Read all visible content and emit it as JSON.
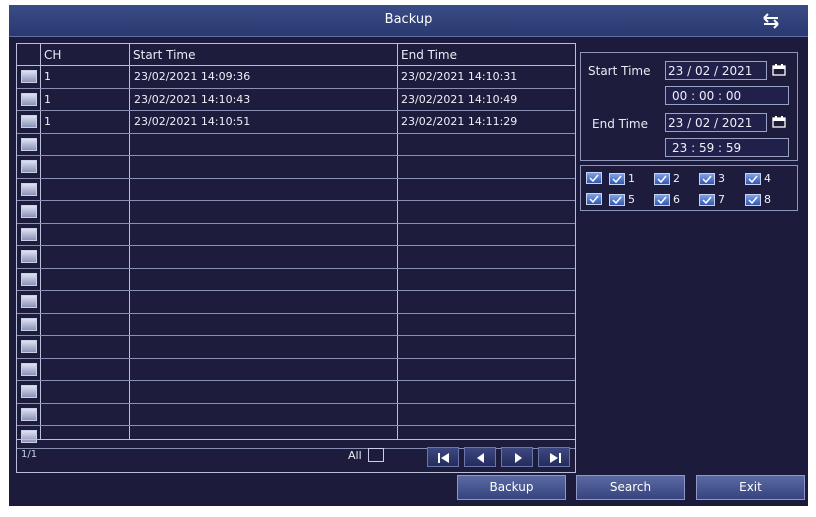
{
  "window": {
    "title": "Backup"
  },
  "table": {
    "headers": {
      "ch": "CH",
      "start": "Start Time",
      "end": "End Time"
    },
    "rows": [
      {
        "ch": "1",
        "start": "23/02/2021 14:09:36",
        "end": "23/02/2021 14:10:31"
      },
      {
        "ch": "1",
        "start": "23/02/2021 14:10:43",
        "end": "23/02/2021 14:10:49"
      },
      {
        "ch": "1",
        "start": "23/02/2021 14:10:51",
        "end": "23/02/2021 14:11:29"
      },
      {
        "ch": "",
        "start": "",
        "end": ""
      },
      {
        "ch": "",
        "start": "",
        "end": ""
      },
      {
        "ch": "",
        "start": "",
        "end": ""
      },
      {
        "ch": "",
        "start": "",
        "end": ""
      },
      {
        "ch": "",
        "start": "",
        "end": ""
      },
      {
        "ch": "",
        "start": "",
        "end": ""
      },
      {
        "ch": "",
        "start": "",
        "end": ""
      },
      {
        "ch": "",
        "start": "",
        "end": ""
      },
      {
        "ch": "",
        "start": "",
        "end": ""
      },
      {
        "ch": "",
        "start": "",
        "end": ""
      },
      {
        "ch": "",
        "start": "",
        "end": ""
      },
      {
        "ch": "",
        "start": "",
        "end": ""
      },
      {
        "ch": "",
        "start": "",
        "end": ""
      },
      {
        "ch": "",
        "start": "",
        "end": ""
      }
    ],
    "page_indicator": "1/1",
    "select_all_label": "All"
  },
  "search": {
    "start_label": "Start Time",
    "start_date": "23 / 02 / 2021",
    "start_time": "00  :  00  :  00",
    "end_label": "End Time",
    "end_date": "23 / 02 / 2021",
    "end_time": "23  :  59  :  59"
  },
  "channels": [
    "1",
    "2",
    "3",
    "4",
    "5",
    "6",
    "7",
    "8"
  ],
  "buttons": {
    "backup": "Backup",
    "search": "Search",
    "exit": "Exit"
  },
  "colors": {
    "background": "#1c1b3c",
    "titlebar": "#2a3970",
    "button": "#4a5892",
    "checkbox_checked": "#5a7fd0"
  },
  "icons": {
    "return": "return-icon",
    "calendar": "calendar-icon",
    "first": "first-page-icon",
    "prev": "prev-page-icon",
    "next": "next-page-icon",
    "last": "last-page-icon"
  }
}
